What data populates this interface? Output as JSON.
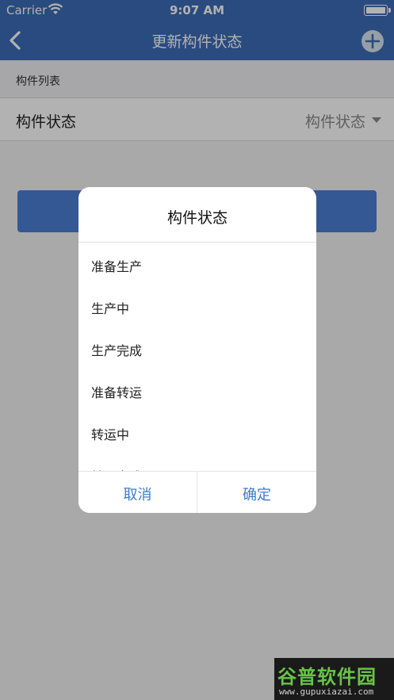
{
  "status_bar": {
    "carrier": "Carrier",
    "time": "9:07 AM",
    "icons": [
      "wifi-icon",
      "battery-icon"
    ]
  },
  "nav": {
    "title": "更新构件状态",
    "left_icon": "chevron-left-icon",
    "right_icon": "plus-circle-icon"
  },
  "section_header": {
    "label": "构件列表"
  },
  "form_row": {
    "label": "构件状态",
    "value": "构件状态",
    "icon": "caret-down-icon"
  },
  "dialog": {
    "title": "构件状态",
    "options": [
      "准备生产",
      "生产中",
      "生产完成",
      "准备转运",
      "转运中",
      "转运完成"
    ],
    "cancel_label": "取消",
    "confirm_label": "确定"
  },
  "watermark": {
    "text": "谷普软件园",
    "url": "www.gupuxiazai.com"
  },
  "colors": {
    "nav_bar": "#3b6cb7",
    "button_text": "#3d7cc9",
    "submit_button": "#4a7fd4",
    "watermark_green": "#6ac14a"
  }
}
